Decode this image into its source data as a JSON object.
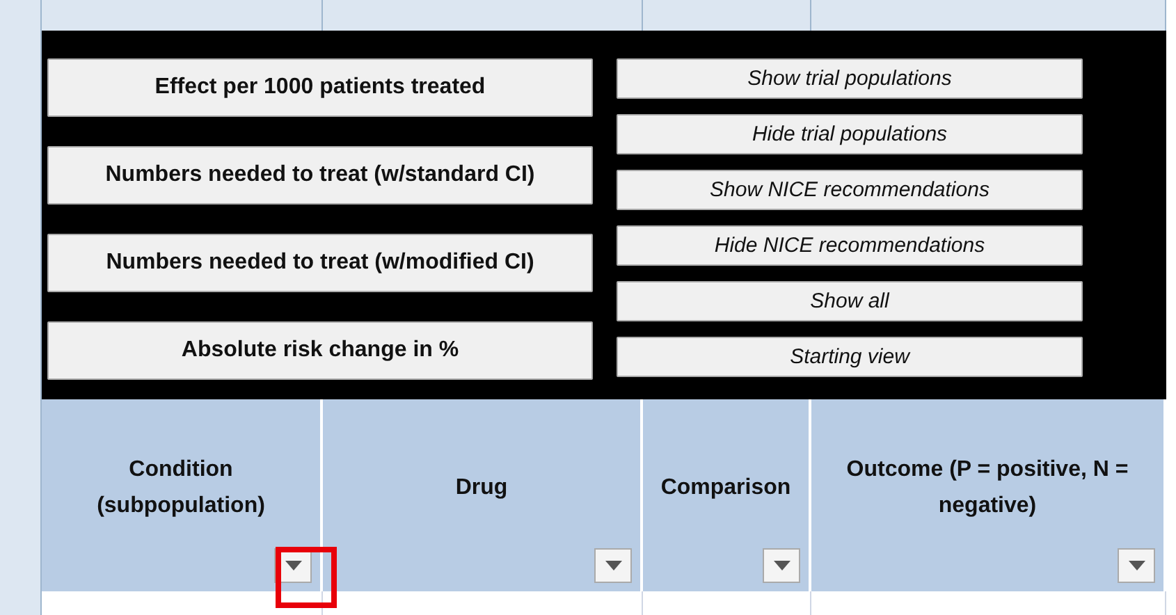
{
  "left_buttons": [
    "Effect per 1000 patients treated",
    "Numbers needed to treat (w/standard CI)",
    "Numbers needed to treat (w/modified CI)",
    "Absolute risk change in %"
  ],
  "right_buttons": [
    "Show trial populations",
    "Hide trial populations",
    "Show NICE recommendations",
    "Hide NICE recommendations",
    "Show all",
    "Starting view"
  ],
  "columns": [
    {
      "header": "Condition (subpopulation)",
      "highlighted": true
    },
    {
      "header": "Drug",
      "highlighted": false
    },
    {
      "header": "Comparison",
      "highlighted": false
    },
    {
      "header": "Outcome (P = positive, N = negative)",
      "highlighted": false
    }
  ]
}
